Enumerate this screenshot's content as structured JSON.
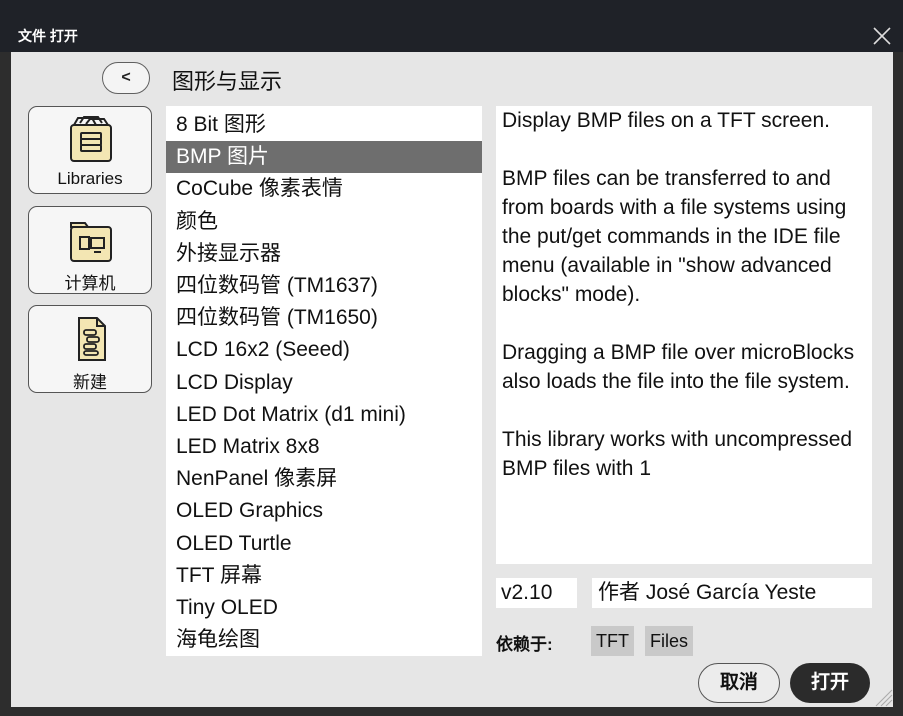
{
  "window": {
    "title": "文件 打开"
  },
  "nav": {
    "back_label": "<",
    "category": "图形与显示"
  },
  "sidebar": [
    {
      "label": "Libraries",
      "icon": "libraries-icon"
    },
    {
      "label": "计算机",
      "icon": "computer-folder-icon"
    },
    {
      "label": "新建",
      "icon": "new-script-icon"
    }
  ],
  "libraries": [
    "8 Bit 图形",
    "BMP 图片",
    "CoCube 像素表情",
    "颜色",
    "外接显示器",
    "四位数码管 (TM1637)",
    "四位数码管 (TM1650)",
    "LCD 16x2 (Seeed)",
    "LCD Display",
    "LED Dot Matrix (d1 mini)",
    "LED Matrix 8x8",
    "NenPanel 像素屏",
    "OLED Graphics",
    "OLED Turtle",
    "TFT 屏幕",
    "Tiny OLED",
    "海龟绘图"
  ],
  "selected_index": 1,
  "details": {
    "paragraphs": [
      "Display BMP files on a TFT screen.",
      "BMP files can be transferred to and from boards with a file systems using the put/get commands in the IDE file menu (available in \"show advanced blocks\" mode).",
      "Dragging a BMP file over microBlocks also loads the file into the file system.",
      "This library works with uncompressed BMP files with 1"
    ],
    "version": "v2.10",
    "author": "作者 José García Yeste",
    "depends_label": "依赖于:",
    "depends": [
      "TFT",
      "Files"
    ]
  },
  "buttons": {
    "cancel": "取消",
    "open": "打开"
  }
}
